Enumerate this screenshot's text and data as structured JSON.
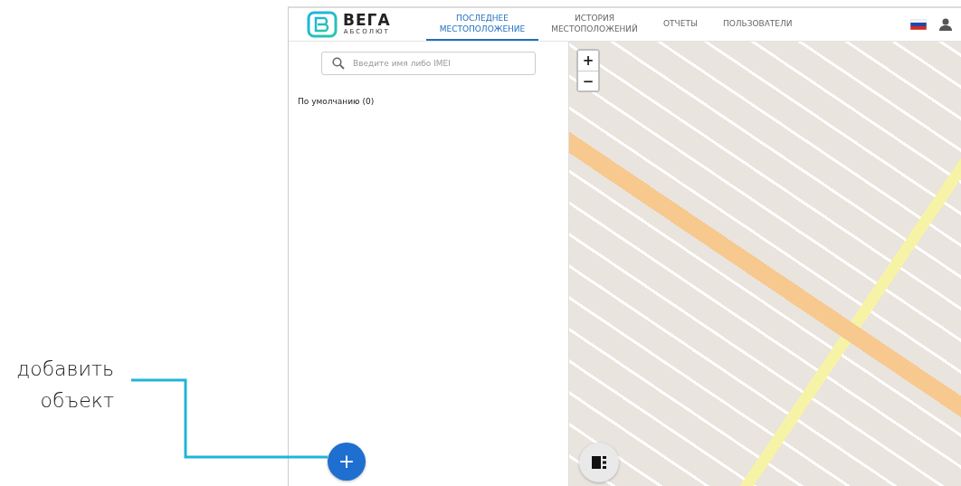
{
  "annotation": {
    "text": "добавить объект"
  },
  "logo": {
    "name": "ВЕГА",
    "tagline": "АБСОЛЮТ"
  },
  "tabs": [
    {
      "label": "ПОСЛЕДНЕЕ МЕСТОПОЛОЖЕНИЕ",
      "selected": true
    },
    {
      "label": "ИСТОРИЯ МЕСТОПОЛОЖЕНИЙ",
      "selected": false
    },
    {
      "label": "ОТЧЕТЫ",
      "selected": false
    },
    {
      "label": "ПОЛЬЗОВАТЕЛИ",
      "selected": false
    }
  ],
  "search": {
    "placeholder": "Введите имя либо IMEI"
  },
  "groups": [
    {
      "label": "По умолчанию (0)"
    }
  ],
  "map": {
    "zoom_in": "+",
    "zoom_out": "−"
  },
  "add_button": {
    "label": "+"
  }
}
